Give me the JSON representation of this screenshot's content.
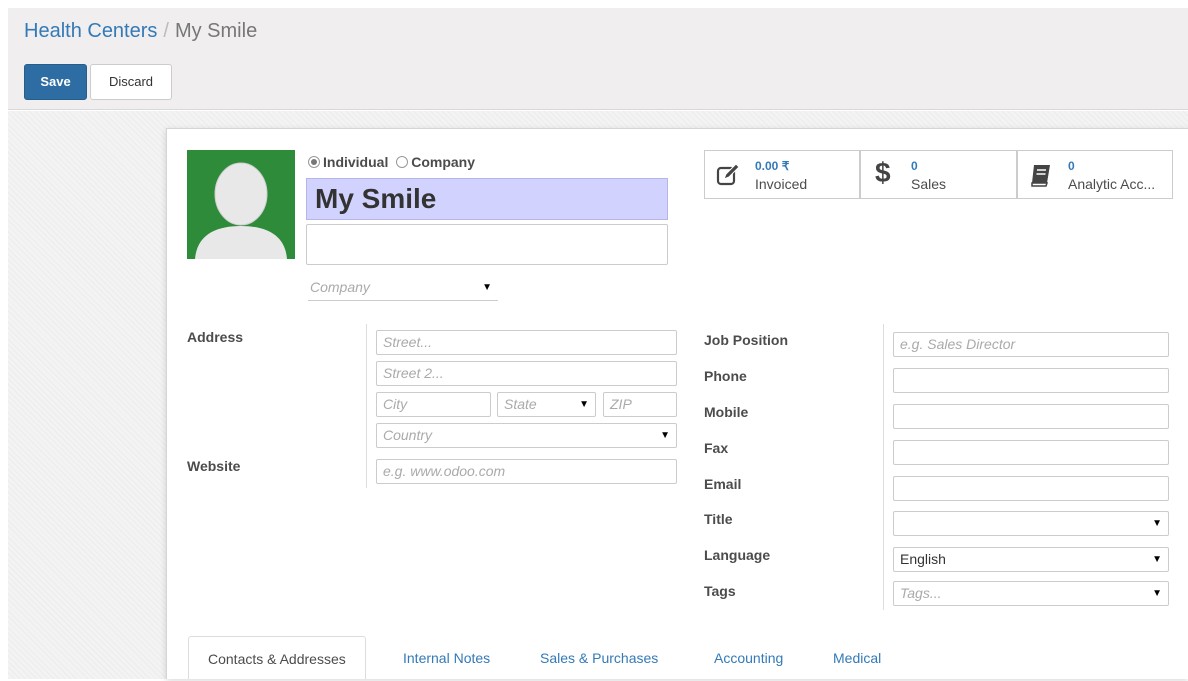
{
  "breadcrumb": {
    "parent": "Health Centers",
    "separator": "/",
    "current": "My Smile"
  },
  "actions": {
    "save": "Save",
    "discard": "Discard"
  },
  "partner": {
    "type_options": [
      "Individual",
      "Company"
    ],
    "type_selected": "Individual",
    "name": "My Smile",
    "company_placeholder": "Company"
  },
  "stats": [
    {
      "value": "0.00 ₹",
      "label": "Invoiced",
      "icon": "pencil-square-icon"
    },
    {
      "value": "0",
      "label": "Sales",
      "icon": "dollar-icon"
    },
    {
      "value": "0",
      "label": "Analytic Acc...",
      "icon": "book-icon"
    }
  ],
  "address": {
    "label": "Address",
    "street_placeholder": "Street...",
    "street2_placeholder": "Street 2...",
    "city_placeholder": "City",
    "state_placeholder": "State",
    "zip_placeholder": "ZIP",
    "country_placeholder": "Country"
  },
  "website": {
    "label": "Website",
    "placeholder": "e.g. www.odoo.com"
  },
  "right_fields": {
    "job_position": {
      "label": "Job Position",
      "placeholder": "e.g. Sales Director"
    },
    "phone": {
      "label": "Phone"
    },
    "mobile": {
      "label": "Mobile"
    },
    "fax": {
      "label": "Fax"
    },
    "email": {
      "label": "Email"
    },
    "title": {
      "label": "Title",
      "value": ""
    },
    "language": {
      "label": "Language",
      "value": "English"
    },
    "tags": {
      "label": "Tags",
      "placeholder": "Tags..."
    }
  },
  "tabs": [
    "Contacts & Addresses",
    "Internal Notes",
    "Sales & Purchases",
    "Accounting",
    "Medical"
  ],
  "active_tab": "Contacts & Addresses",
  "colors": {
    "save_button": "#2e6da4",
    "link": "#337ab7",
    "name_highlight": "#d2d2ff",
    "avatar_bg": "#2e8b3a"
  }
}
